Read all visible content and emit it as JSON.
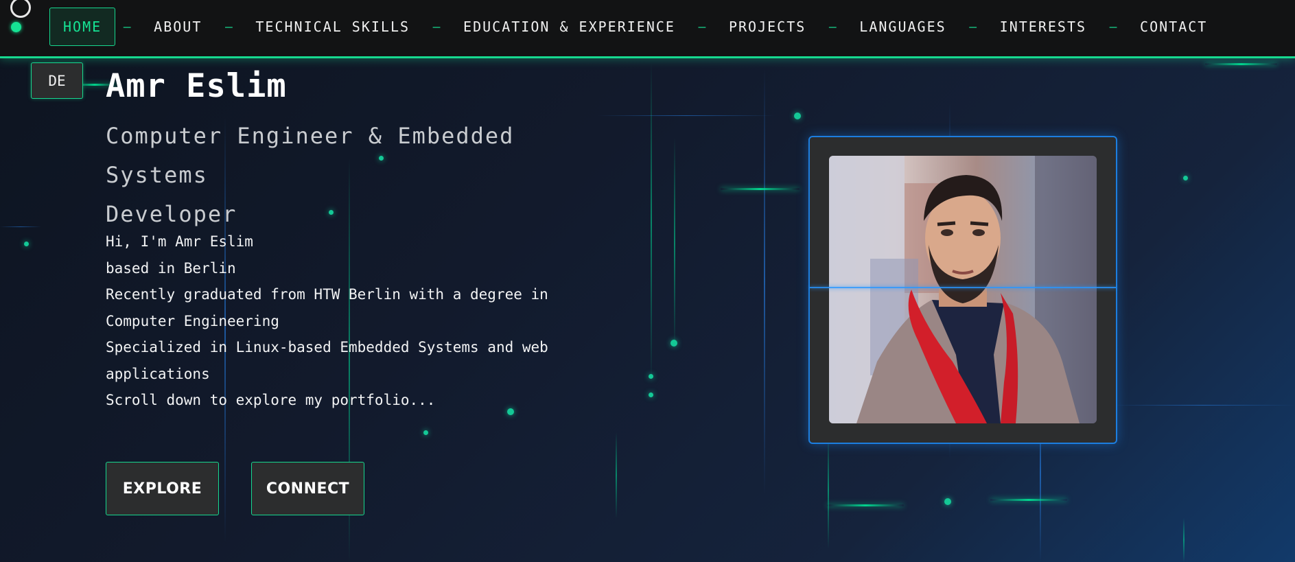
{
  "nav": {
    "items": [
      {
        "label": "HOME",
        "active": true
      },
      {
        "label": "ABOUT"
      },
      {
        "label": "TECHNICAL SKILLS"
      },
      {
        "label": "EDUCATION & EXPERIENCE"
      },
      {
        "label": "PROJECTS"
      },
      {
        "label": "LANGUAGES"
      },
      {
        "label": "INTERESTS"
      },
      {
        "label": "CONTACT"
      }
    ],
    "separator": "–"
  },
  "language_toggle": "DE",
  "hero": {
    "name": "Amr Eslim",
    "subtitle_lines": [
      "Computer Engineer & Embedded Systems",
      "Developer"
    ],
    "intro_lines": [
      "Hi, I'm Amr Eslim",
      "based in Berlin",
      "Recently graduated from HTW Berlin with a degree in",
      "Computer Engineering",
      "Specialized in Linux-based Embedded Systems and web",
      "applications",
      "Scroll down to explore my portfolio..."
    ],
    "buttons": {
      "explore": "EXPLORE",
      "connect": "CONNECT"
    }
  },
  "colors": {
    "accent": "#16d98f",
    "frame": "#1c7ee0",
    "nav_bg": "#121314"
  },
  "icons": {
    "cursor_ring": "circle-outline-icon",
    "status_dot": "dot-icon",
    "portrait": "profile-photo"
  }
}
